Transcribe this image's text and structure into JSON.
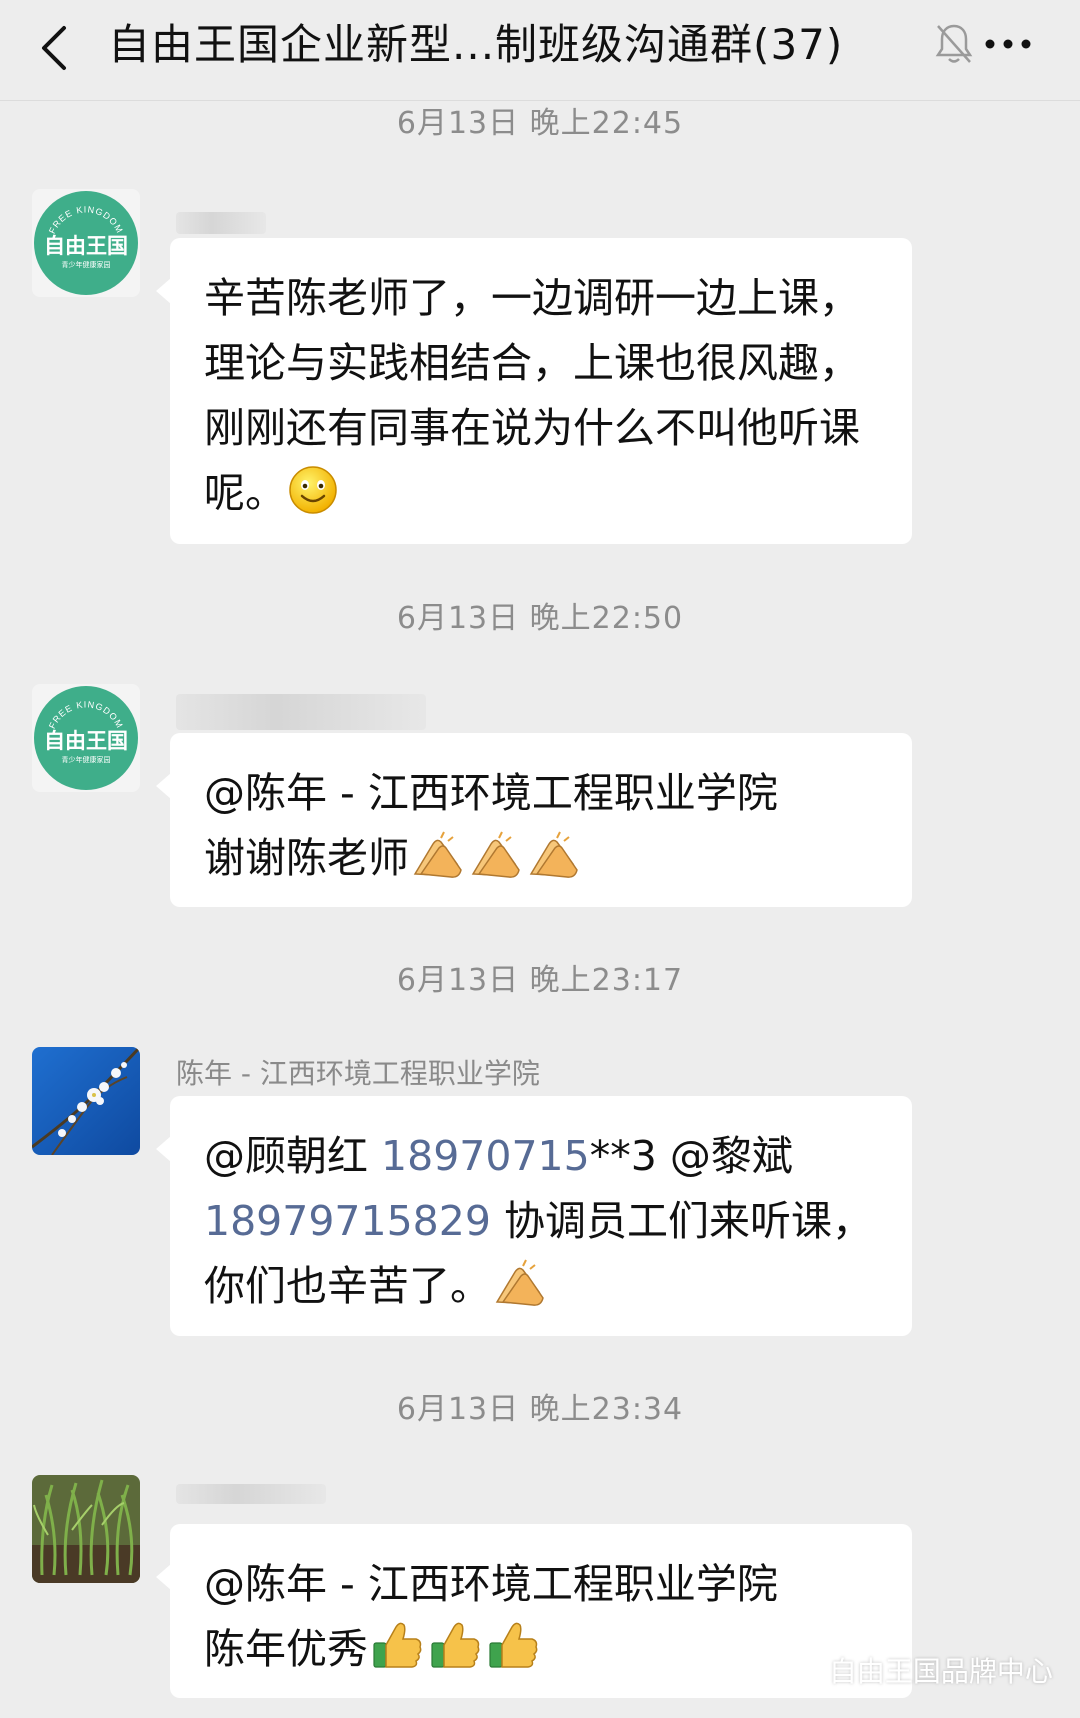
{
  "header": {
    "title": "自由王国企业新型...制班级沟通群(37)",
    "back_icon": "chevron-left-icon",
    "mute_icon": "bell-off-icon",
    "more_icon": "more-dots-icon"
  },
  "messages": [
    {
      "time": "6月13日 晚上22:45",
      "sender": "",
      "avatar": "free-kingdom-logo",
      "text": "辛苦陈老师了，一边调研一边上课，理论与实践相结合，上课也很风趣，刚刚还有同事在说为什么不叫他听课呢。",
      "emoji": "smile-emoji"
    },
    {
      "time": "6月13日 晚上22:50",
      "sender": "",
      "avatar": "free-kingdom-logo",
      "mention": "@陈年 - 江西环境工程职业学院",
      "text": "谢谢陈老师",
      "emoji": "clap-hands-emoji"
    },
    {
      "time": "6月13日 晚上23:17",
      "sender": "陈年 - 江西环境工程职业学院",
      "avatar": "flower-branch-photo",
      "mention1": "@顾朝红",
      "phone1": "18970715",
      "phone1_suffix": "**3",
      "mention2": "@黎斌",
      "phone2": "18979715829",
      "text": "协调员工们来听课，你们也辛苦了。",
      "emoji": "clap-hands-emoji"
    },
    {
      "time": "6月13日 晚上23:34",
      "sender": "",
      "avatar": "green-plants-photo",
      "mention": "@陈年 - 江西环境工程职业学院",
      "text": "陈年优秀",
      "emoji": "thumbs-up-emoji"
    }
  ],
  "avatar_logo": {
    "arc_text": "FREE KINGDOM",
    "main_text": "自由王国",
    "sub_text": "青少年健康家园",
    "bg_color": "#3fae8a"
  },
  "watermark": "自由王国品牌中心",
  "colors": {
    "background": "#ededed",
    "bubble": "#ffffff",
    "link": "#576b95",
    "time": "#8c8c8c"
  }
}
